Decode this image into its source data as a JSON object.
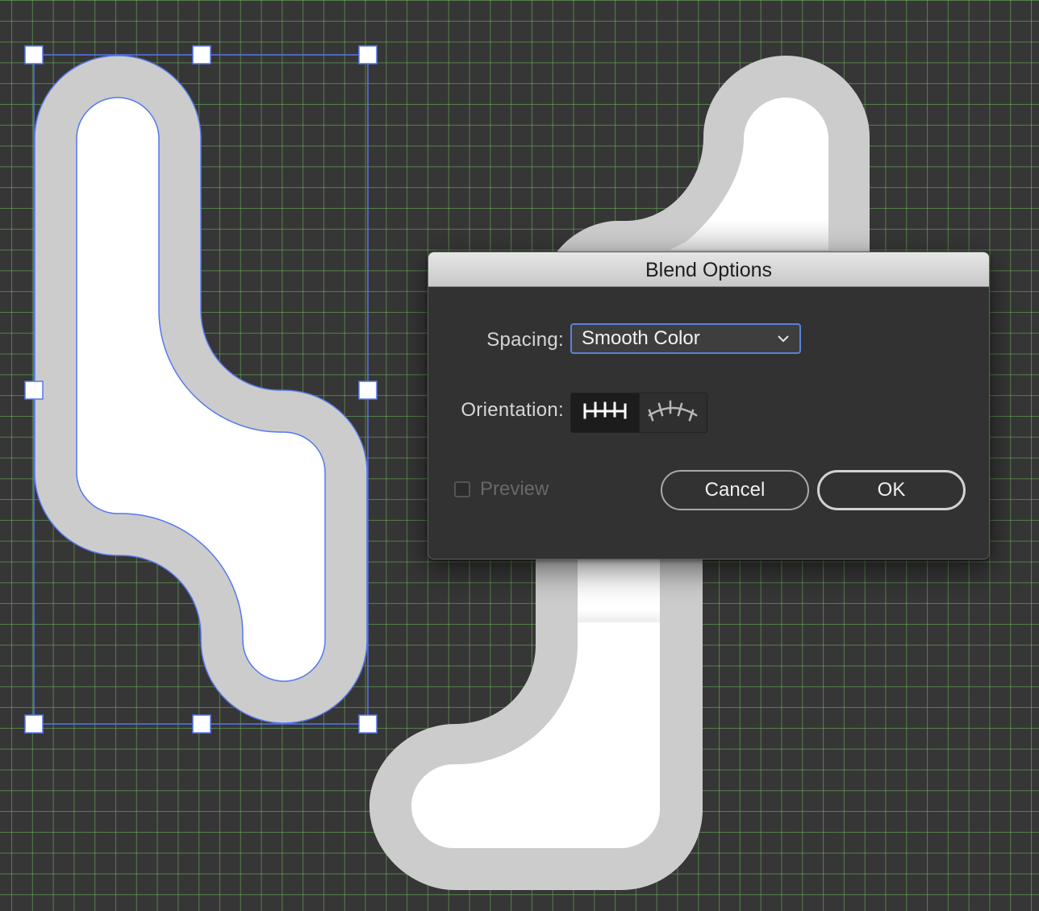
{
  "dialog": {
    "title": "Blend Options",
    "spacing_label": "Spacing:",
    "spacing_value": "Smooth Color",
    "orientation_label": "Orientation:",
    "orientation_options": [
      "align-to-page-icon",
      "align-to-path-icon"
    ],
    "orientation_selected": "align-to-page-icon",
    "preview_label": "Preview",
    "preview_checked": false,
    "cancel_label": "Cancel",
    "ok_label": "OK"
  },
  "canvas": {
    "grid_color": "#6ebe5a",
    "background": "#363636",
    "shape_stroke": "#cccccc",
    "shape_fill": "#ffffff",
    "selection_color": "#5577ee"
  }
}
